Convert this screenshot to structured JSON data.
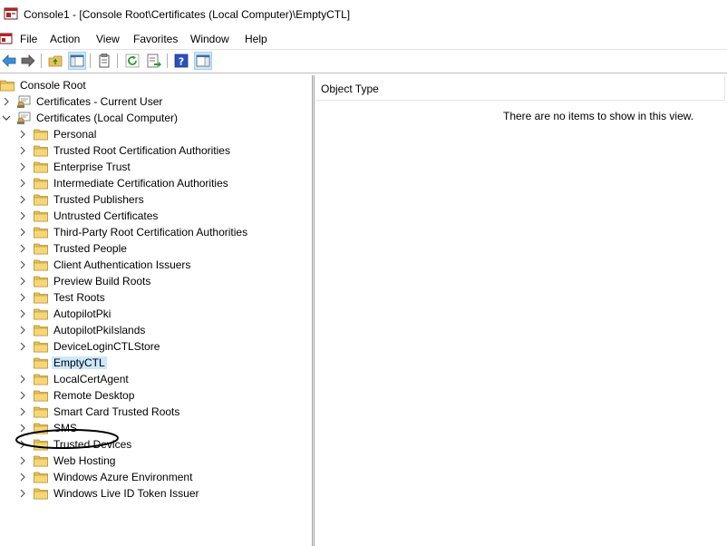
{
  "window": {
    "title": "Console1 - [Console Root\\Certificates (Local Computer)\\EmptyCTL]"
  },
  "menu": [
    "File",
    "Action",
    "View",
    "Favorites",
    "Window",
    "Help"
  ],
  "toolbar": {
    "buttons": [
      "back-icon",
      "forward-icon",
      "up-folder-icon",
      "show-hide-tree-icon",
      "properties-icon",
      "refresh-icon",
      "export-list-icon",
      "help-icon",
      "show-hide-action-pane-icon"
    ]
  },
  "tree": {
    "root": "Console Root",
    "current_user": "Certificates - Current User",
    "local_computer": "Certificates (Local Computer)",
    "stores": [
      "Personal",
      "Trusted Root Certification Authorities",
      "Enterprise Trust",
      "Intermediate Certification Authorities",
      "Trusted Publishers",
      "Untrusted Certificates",
      "Third-Party Root Certification Authorities",
      "Trusted People",
      "Client Authentication Issuers",
      "Preview Build Roots",
      "Test Roots",
      "AutopilotPki",
      "AutopilotPkiIslands",
      "DeviceLoginCTLStore",
      "EmptyCTL",
      "LocalCertAgent",
      "Remote Desktop",
      "Smart Card Trusted Roots",
      "SMS",
      "Trusted Devices",
      "Web Hosting",
      "Windows Azure Environment",
      "Windows Live ID Token Issuer"
    ],
    "selected": "EmptyCTL"
  },
  "details": {
    "column_header": "Object Type",
    "empty_message": "There are no items to show in this view."
  },
  "colors": {
    "folder": "#e8c15a",
    "selection": "#cce8ff",
    "annotation": "#000000"
  }
}
